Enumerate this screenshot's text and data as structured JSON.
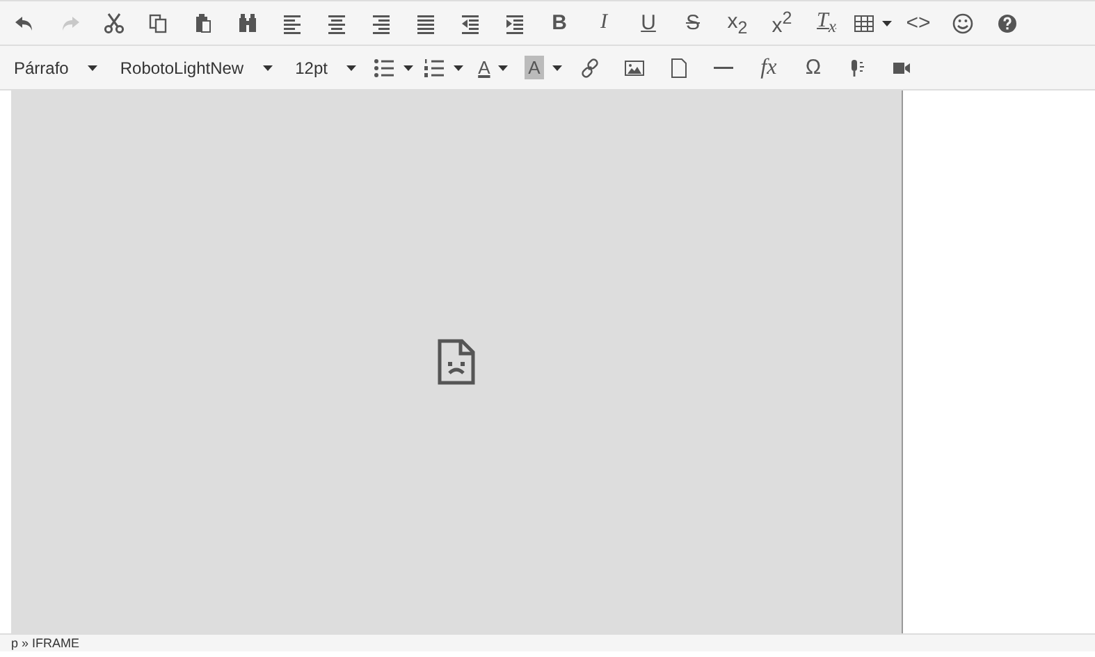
{
  "toolbar_1": [
    {
      "disabled": false
    },
    {
      "disabled": true
    },
    {
      "disabled": false
    },
    {
      "disabled": false
    },
    {
      "disabled": false
    },
    {
      "disabled": false
    },
    {
      "disabled": false
    },
    {
      "disabled": false
    },
    {
      "disabled": false
    },
    {
      "disabled": false
    },
    {
      "disabled": false
    },
    {
      "disabled": false
    },
    {
      "label": "B",
      "disabled": false
    },
    {
      "label": "I",
      "disabled": false
    },
    {
      "label": "U",
      "disabled": false
    },
    {
      "label": "S",
      "disabled": false
    },
    {
      "label": "x$_{2}$",
      "disabled": false
    },
    {
      "label": "x$^{2}$",
      "disabled": false
    },
    {
      "label": "T$_{x}$",
      "disabled": false
    },
    {
      "disabled": false
    },
    {
      "label": "<>",
      "disabled": false
    },
    {
      "disabled": false
    },
    {
      "disabled": false
    }
  ],
  "toolbar_2": [
    {
      "label": "Párrafo",
      "kind": "select"
    },
    {
      "label": "RobotoLightNew",
      "kind": "select"
    },
    {
      "label": "12pt",
      "kind": "select"
    },
    {
      "kind": "split"
    },
    {
      "kind": "split"
    },
    {
      "label": "A",
      "kind": "color-split"
    },
    {
      "label": "A",
      "kind": "bg-split"
    },
    {
      "kind": "icon"
    },
    {
      "kind": "icon"
    },
    {
      "kind": "icon"
    },
    {
      "kind": "icon"
    },
    {
      "label": "fx",
      "kind": "text"
    },
    {
      "label": "Ω",
      "kind": "text"
    },
    {
      "kind": "icon"
    },
    {
      "kind": "icon"
    }
  ],
  "status_bar": {
    "path": "p » IFRAME"
  }
}
